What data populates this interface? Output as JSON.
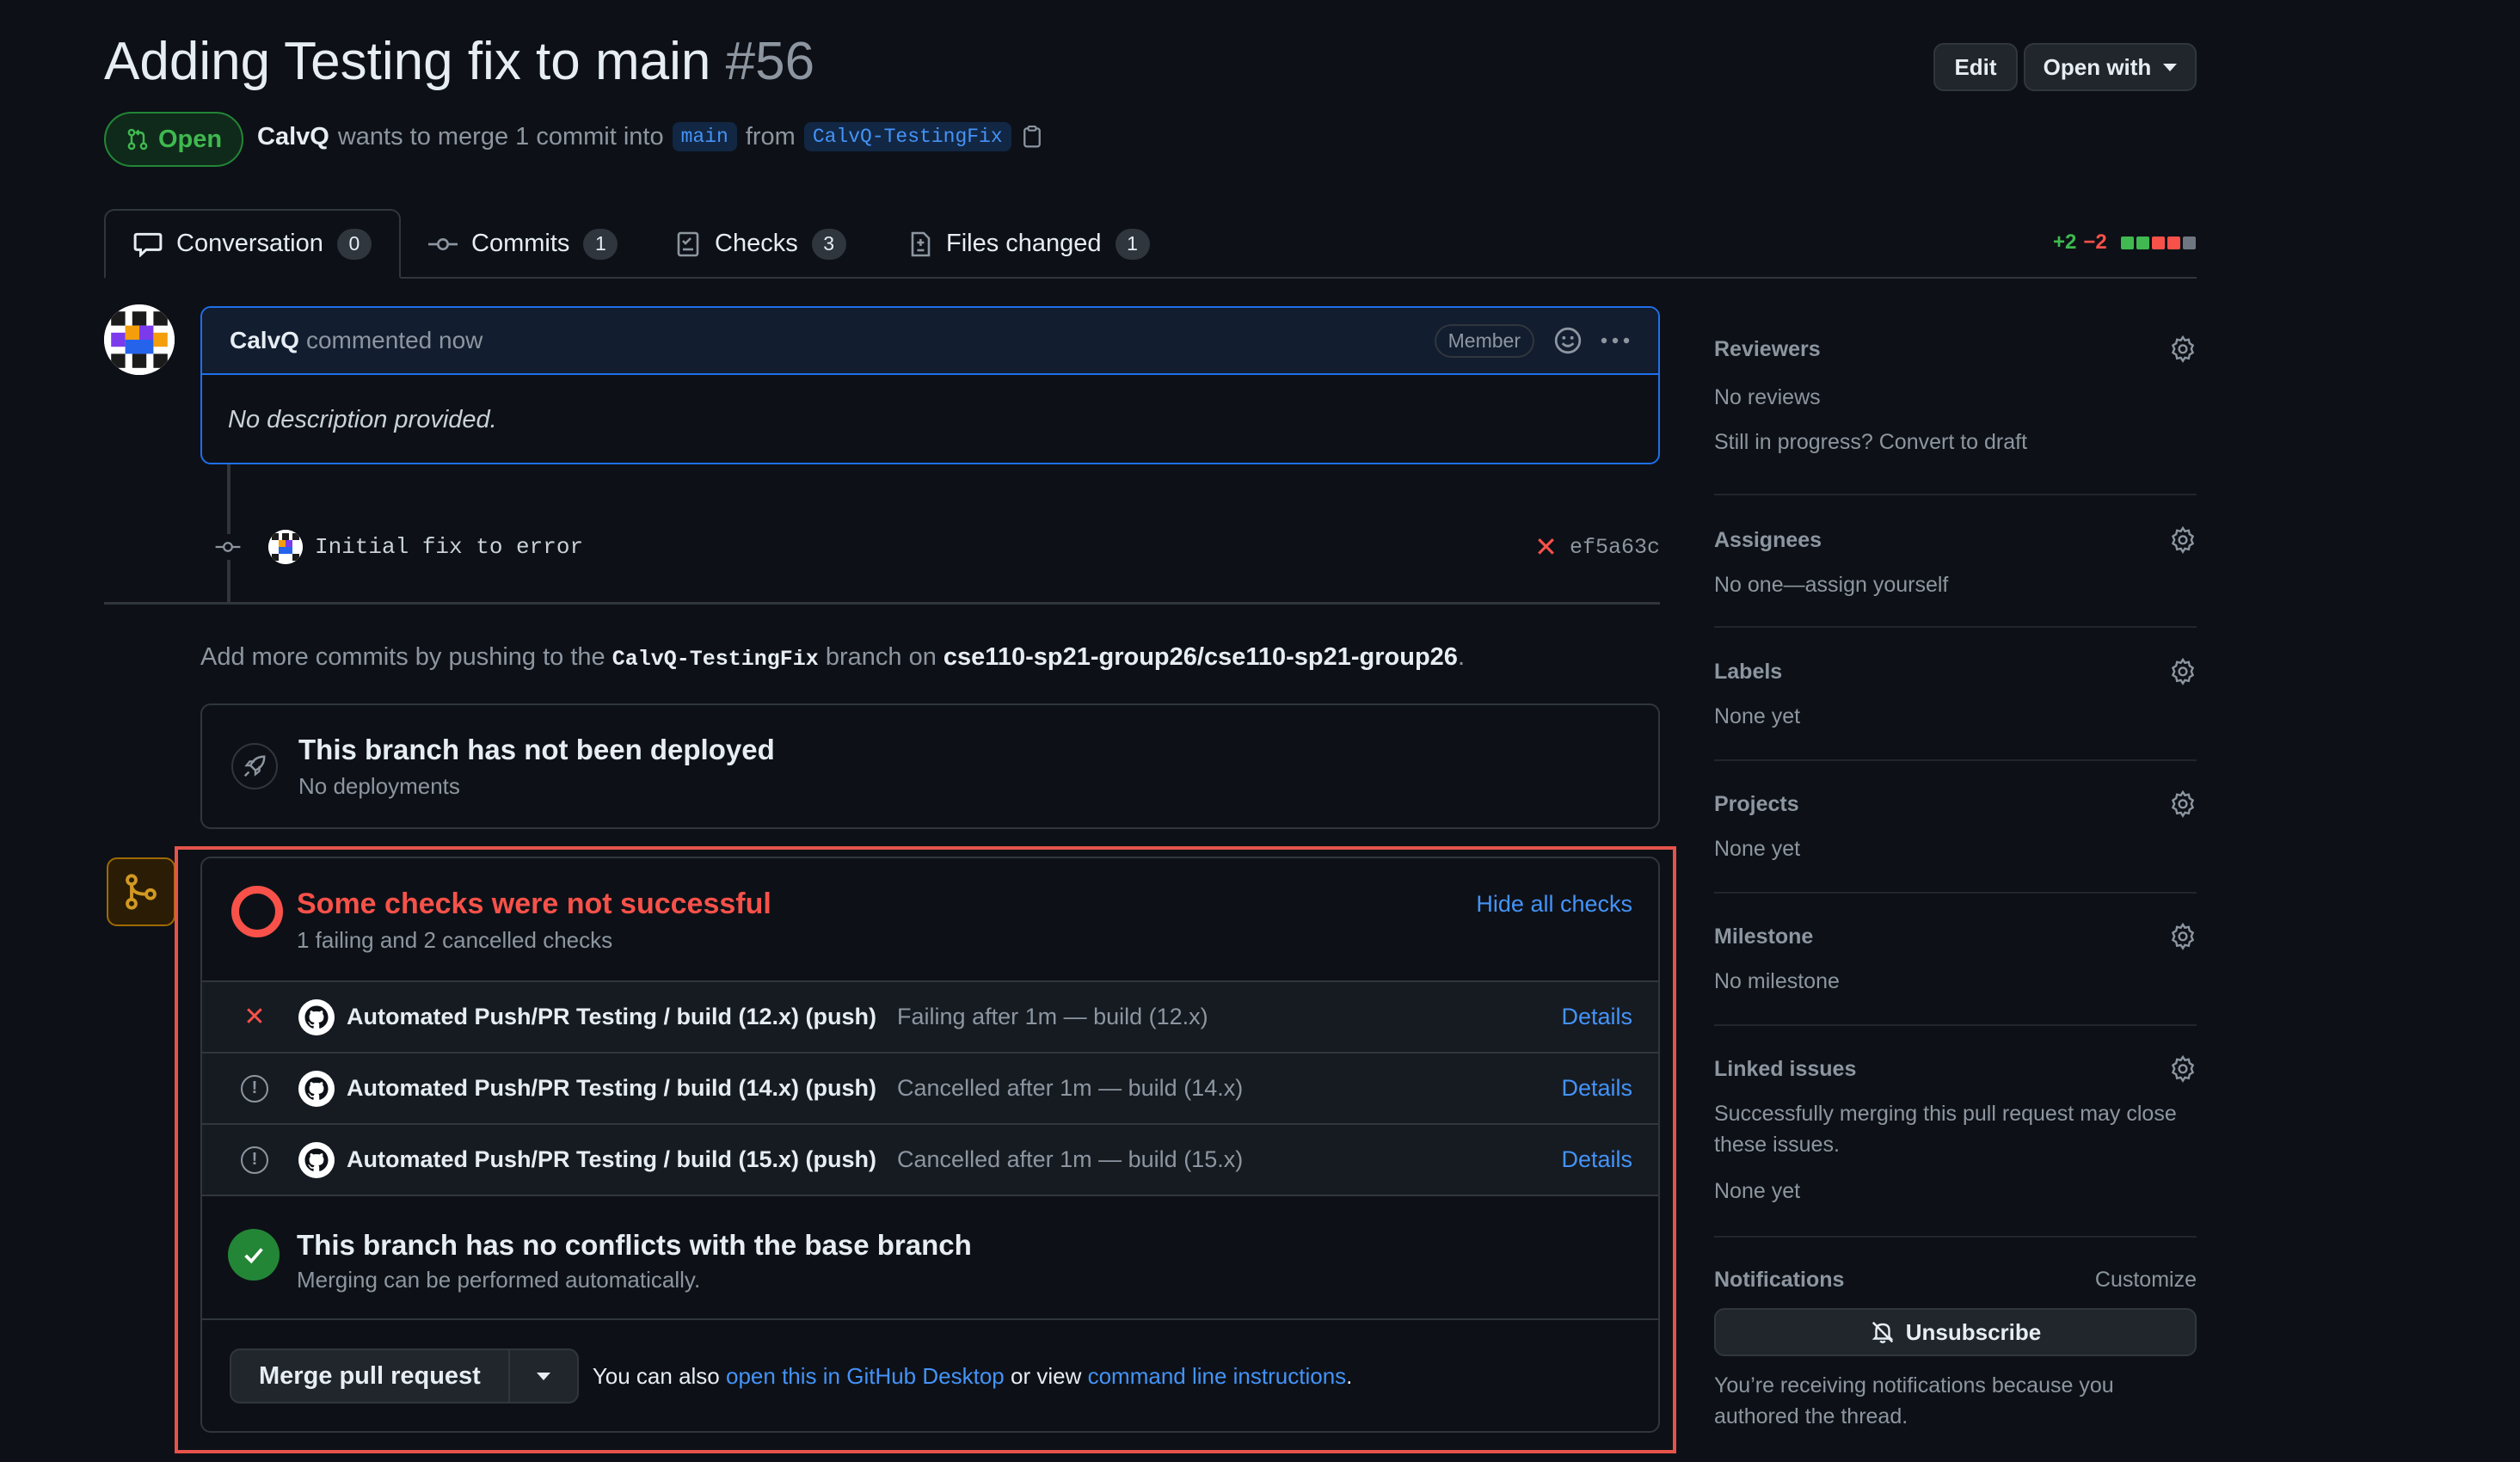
{
  "pr": {
    "title": "Adding Testing fix to main",
    "number": "#56",
    "state": "Open",
    "author": "CalvQ",
    "merge_text": "wants to merge 1 commit into",
    "base_branch": "main",
    "from_text": "from",
    "head_branch": "CalvQ-TestingFix"
  },
  "header_buttons": {
    "edit": "Edit",
    "open_with": "Open with"
  },
  "tabs": [
    {
      "label": "Conversation",
      "count": "0"
    },
    {
      "label": "Commits",
      "count": "1"
    },
    {
      "label": "Checks",
      "count": "3"
    },
    {
      "label": "Files changed",
      "count": "1"
    }
  ],
  "diffstat": {
    "additions": "+2",
    "deletions": "−2",
    "colors": [
      "#3fb950",
      "#3fb950",
      "#f85149",
      "#f85149",
      "#6e7681"
    ]
  },
  "comment": {
    "author": "CalvQ",
    "time": "commented now",
    "badge": "Member",
    "body": "No description provided."
  },
  "commit": {
    "message": "Initial fix to error",
    "sha": "ef5a63c",
    "status": "failed"
  },
  "push_note": {
    "prefix": "Add more commits by pushing to the",
    "branch": "CalvQ-TestingFix",
    "middle": "branch on",
    "repo": "cse110-sp21-group26/cse110-sp21-group26",
    "suffix": "."
  },
  "deploy": {
    "title": "This branch has not been deployed",
    "subtitle": "No deployments"
  },
  "checks": {
    "title": "Some checks were not successful",
    "subtitle": "1 failing and 2 cancelled checks",
    "hide_label": "Hide all checks",
    "items": [
      {
        "status": "failed",
        "name": "Automated Push/PR Testing / build (12.x) (push)",
        "desc": "Failing after 1m — build (12.x)",
        "details": "Details"
      },
      {
        "status": "cancelled",
        "name": "Automated Push/PR Testing / build (14.x) (push)",
        "desc": "Cancelled after 1m — build (14.x)",
        "details": "Details"
      },
      {
        "status": "cancelled",
        "name": "Automated Push/PR Testing / build (15.x) (push)",
        "desc": "Cancelled after 1m — build (15.x)",
        "details": "Details"
      }
    ]
  },
  "conflicts": {
    "title": "This branch has no conflicts with the base branch",
    "subtitle": "Merging can be performed automatically."
  },
  "merge": {
    "button": "Merge pull request",
    "hint_prefix": "You can also",
    "desktop_link": "open this in GitHub Desktop",
    "hint_middle": "or view",
    "cli_link": "command line instructions",
    "hint_suffix": "."
  },
  "sidebar": {
    "reviewers": {
      "title": "Reviewers",
      "value": "No reviews",
      "draft": "Still in progress? Convert to draft"
    },
    "assignees": {
      "title": "Assignees",
      "value": "No one—assign yourself"
    },
    "labels": {
      "title": "Labels",
      "value": "None yet"
    },
    "projects": {
      "title": "Projects",
      "value": "None yet"
    },
    "milestone": {
      "title": "Milestone",
      "value": "No milestone"
    },
    "linked_issues": {
      "title": "Linked issues",
      "description": "Successfully merging this pull request may close these issues.",
      "value": "None yet"
    },
    "notifications": {
      "title": "Notifications",
      "customize": "Customize",
      "button": "Unsubscribe",
      "reason": "You’re receiving notifications because you authored the thread."
    }
  },
  "colors": {
    "background": "#0d1117",
    "accent": "#4493f8",
    "danger": "#f85149",
    "success": "#238636",
    "highlight": "#e5534b"
  }
}
